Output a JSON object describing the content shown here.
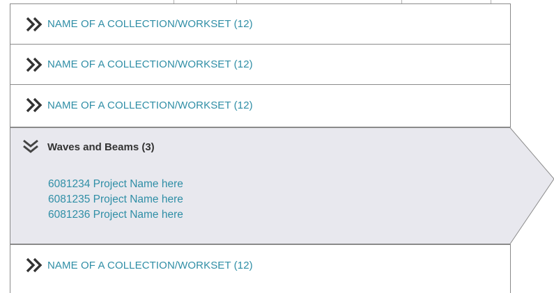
{
  "collections": [
    {
      "label": "NAME OF A COLLECTION/WORKSET (12)"
    },
    {
      "label": "NAME OF A COLLECTION/WORKSET (12)"
    },
    {
      "label": "NAME OF A COLLECTION/WORKSET (12)"
    }
  ],
  "expanded": {
    "title": "Waves and Beams (3)",
    "projects": [
      {
        "label": "6081234 Project Name here"
      },
      {
        "label": "6081235 Project Name here"
      },
      {
        "label": "6081236 Project Name here"
      }
    ]
  },
  "collections_after": [
    {
      "label": "NAME OF A COLLECTION/WORKSET (12)"
    }
  ],
  "icons": {
    "collapsed": "double-chevron-right-icon",
    "expanded": "double-chevron-down-icon"
  },
  "colors": {
    "link": "#2f8ea6",
    "expanded_bg": "#e8e8ee",
    "border": "#8a8a8a",
    "chevron": "#333333"
  }
}
